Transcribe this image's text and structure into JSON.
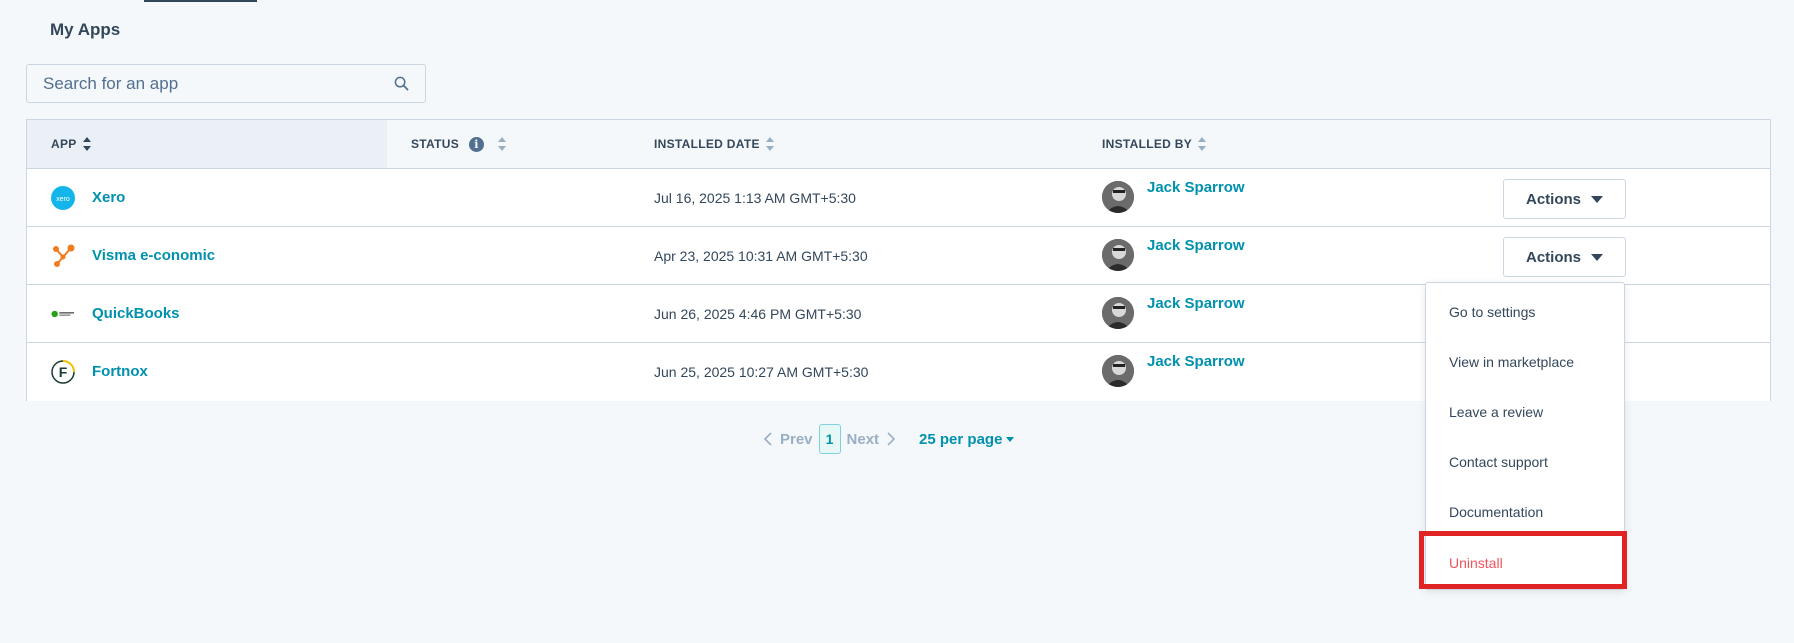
{
  "page": {
    "title": "My Apps"
  },
  "search": {
    "placeholder": "Search for an app"
  },
  "table": {
    "columns": {
      "app": "APP",
      "status": "STATUS",
      "installed_date": "INSTALLED DATE",
      "installed_by": "INSTALLED BY"
    },
    "rows": [
      {
        "app": "Xero",
        "date": "Jul 16, 2025 1:13 AM GMT+5:30",
        "user": "Jack Sparrow",
        "action": "Actions"
      },
      {
        "app": "Visma e-conomic",
        "date": "Apr 23, 2025 10:31 AM GMT+5:30",
        "user": "Jack Sparrow",
        "action": "Actions"
      },
      {
        "app": "QuickBooks",
        "date": "Jun 26, 2025 4:46 PM GMT+5:30",
        "user": "Jack Sparrow"
      },
      {
        "app": "Fortnox",
        "date": "Jun 25, 2025 10:27 AM GMT+5:30",
        "user": "Jack Sparrow"
      }
    ]
  },
  "pagination": {
    "prev": "Prev",
    "current": "1",
    "next": "Next",
    "per_page": "25 per page"
  },
  "menu": {
    "items": [
      "Go to settings",
      "View in marketplace",
      "Leave a review",
      "Contact support",
      "Documentation",
      "Uninstall"
    ]
  },
  "colors": {
    "link": "#0091ae",
    "text": "#33475b",
    "danger": "#f2545b",
    "highlight": "#e02424",
    "xero": "#13b5ea",
    "visma": "#f07c1f",
    "quickbooks": "#2ca01c",
    "fortnox": "#1a3d2e"
  },
  "icons": {
    "search": "search-icon",
    "info": "info-icon",
    "sort": "sort-icon",
    "caret": "chevron-down-icon"
  }
}
